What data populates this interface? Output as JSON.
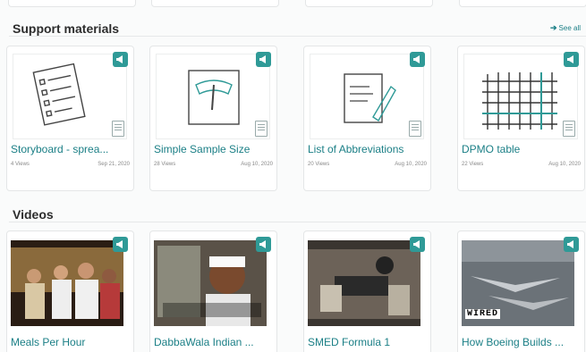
{
  "support": {
    "title": "Support materials",
    "see_all": "See all",
    "items": [
      {
        "title": "Storyboard - sprea...",
        "views": "4 Views",
        "date": "Sep 21, 2020",
        "icon": "checklist-icon",
        "file": "file-icon"
      },
      {
        "title": "Simple Sample Size",
        "views": "28 Views",
        "date": "Aug 10, 2020",
        "icon": "scale-icon",
        "file": "file-icon"
      },
      {
        "title": "List of Abbreviations",
        "views": "20 Views",
        "date": "Aug 10, 2020",
        "icon": "notepad-pencil-icon",
        "file": "file-icon"
      },
      {
        "title": "DPMO table",
        "views": "22 Views",
        "date": "Aug 10, 2020",
        "icon": "grid-table-icon",
        "file": "file-icon"
      }
    ]
  },
  "videos": {
    "title": "Videos",
    "items": [
      {
        "title": "Meals Per Hour"
      },
      {
        "title": "DabbaWala Indian ..."
      },
      {
        "title": "SMED Formula 1"
      },
      {
        "title": "How Boeing Builds ..."
      }
    ],
    "wired_logo": "WIRED"
  },
  "colors": {
    "accent": "#2f9a97",
    "link": "#1b7f86"
  }
}
